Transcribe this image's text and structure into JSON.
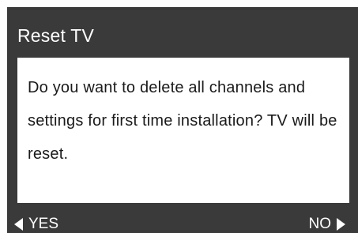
{
  "dialog": {
    "title": "Reset TV",
    "message": "Do you want to delete all channels and settings for first time installation? TV will be reset."
  },
  "options": {
    "yes": {
      "label": "YES",
      "icon": "left-arrow-icon"
    },
    "no": {
      "label": "NO",
      "icon": "right-arrow-icon"
    }
  },
  "colors": {
    "background": "#3a3a3a",
    "message_box": "#ffffff",
    "title_text": "#ffffff",
    "message_text": "#1a1a1a"
  }
}
